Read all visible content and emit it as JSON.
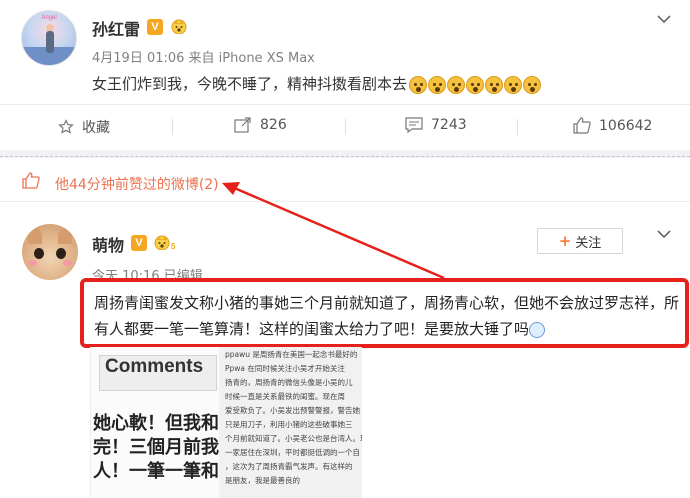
{
  "post1": {
    "username": "孙红雷",
    "verified_badge": "V",
    "meta": "4月19日 01:06 来自 iPhone XS Max",
    "text": "女王们炸到我，今晚不睡了，精神抖擞看剧本去",
    "avatar_caption": "Angel",
    "actions": {
      "favorite_label": "收藏",
      "repost_count": "826",
      "comment_count": "7243",
      "like_count": "106642"
    }
  },
  "liked_header": {
    "text": "他44分钟前赞过的微博(2)"
  },
  "post2": {
    "username": "萌物",
    "verified_badge": "V",
    "level_number": "5",
    "meta": "今天 10:16 已编辑",
    "follow_label": "关注",
    "text": "周扬青闺蜜发文称小猪的事她三个月前就知道了，周扬青心软，但她不会放过罗志祥，所有人都要一笔一笔算清！这样的闺蜜太给力了吧！是要放大锤了吗",
    "embed": {
      "comments_label": "Comments",
      "big_lines": [
        "她心軟！但我和",
        "完！三個月前我",
        "人！一筆一筆和"
      ],
      "small_lines": [
        "ppawu 是周扬青在美国一起念书最好的",
        "Ppwa 在同时候关注小吴才开始关注",
        "扬青的，周扬青的微信头像是小吴的儿",
        "时候一直是关系最铁的闺蜜。现在周",
        "爱受欺负了。小吴发出预警警报，警告她",
        "只是用刀子，利用小猪的这些破事她三",
        "个月前就知道了。小吴老公也是台湾人。现",
        "一家居住在深圳，平时都挺低调的一个自",
        "，这次为了周扬青霸气发声。有这样的",
        "是朋友，我是最善良的"
      ]
    }
  },
  "colors": {
    "accent_orange": "#eb7350",
    "highlight_red": "#e6211b",
    "verified": "#f5a623"
  }
}
